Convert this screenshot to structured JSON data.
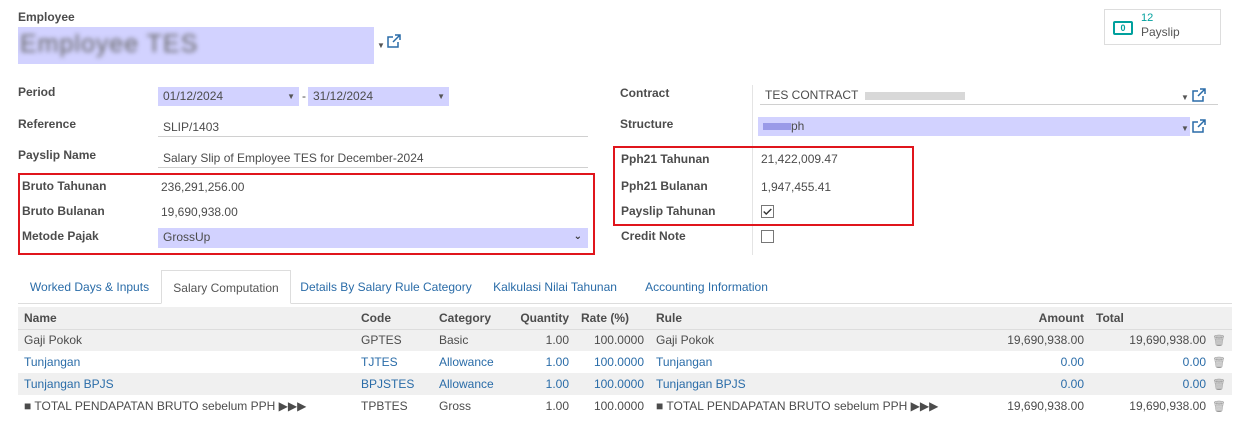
{
  "header": {
    "employee_label": "Employee",
    "employee_name": "Employee TES"
  },
  "smart_button": {
    "count": "12",
    "label": "Payslip",
    "icon": "money-icon"
  },
  "left_fields": {
    "period_label": "Period",
    "period_from": "01/12/2024",
    "period_sep": "-",
    "period_to": "31/12/2024",
    "reference_label": "Reference",
    "reference_value": "SLIP/1403",
    "payslip_name_label": "Payslip Name",
    "payslip_name_value": "Salary Slip of Employee TES for December-2024",
    "bruto_tahunan_label": "Bruto Tahunan",
    "bruto_tahunan_value": "236,291,256.00",
    "bruto_bulanan_label": "Bruto Bulanan",
    "bruto_bulanan_value": "19,690,938.00",
    "metode_pajak_label": "Metode Pajak",
    "metode_pajak_value": "GrossUp"
  },
  "right_fields": {
    "contract_label": "Contract",
    "contract_value": "TES CONTRACT",
    "structure_label": "Structure",
    "structure_value": "ph",
    "pph21_tahunan_label": "Pph21 Tahunan",
    "pph21_tahunan_value": "21,422,009.47",
    "pph21_bulanan_label": "Pph21 Bulanan",
    "pph21_bulanan_value": "1,947,455.41",
    "payslip_tahunan_label": "Payslip Tahunan",
    "payslip_tahunan_checked": true,
    "credit_note_label": "Credit Note",
    "credit_note_checked": false
  },
  "tabs": [
    {
      "label": "Worked Days & Inputs",
      "active": false
    },
    {
      "label": "Salary Computation",
      "active": true
    },
    {
      "label": "Details By Salary Rule Category",
      "active": false
    },
    {
      "label": "Kalkulasi Nilai Tahunan",
      "active": false
    },
    {
      "label": "Accounting Information",
      "active": false
    }
  ],
  "table": {
    "columns": [
      "Name",
      "Code",
      "Category",
      "Quantity",
      "Rate (%)",
      "Rule",
      "Amount",
      "Total"
    ],
    "rows": [
      [
        "Gaji Pokok",
        "GPTES",
        "Basic",
        "1.00",
        "100.0000",
        "Gaji Pokok",
        "19,690,938.00",
        "19,690,938.00"
      ],
      [
        "Tunjangan",
        "TJTES",
        "Allowance",
        "1.00",
        "100.0000",
        "Tunjangan",
        "0.00",
        "0.00"
      ],
      [
        "Tunjangan BPJS",
        "BPJSTES",
        "Allowance",
        "1.00",
        "100.0000",
        "Tunjangan BPJS",
        "0.00",
        "0.00"
      ],
      [
        "■ TOTAL PENDAPATAN BRUTO sebelum PPH ▶▶▶",
        "TPBTES",
        "Gross",
        "1.00",
        "100.0000",
        "■ TOTAL PENDAPATAN BRUTO sebelum PPH ▶▶▶",
        "19,690,938.00",
        "19,690,938.00"
      ]
    ]
  },
  "colors": {
    "required_bg": "#d2d2ff",
    "link": "#2a6ca8",
    "highlight_border": "#e0151c",
    "accent": "#00a09d"
  }
}
